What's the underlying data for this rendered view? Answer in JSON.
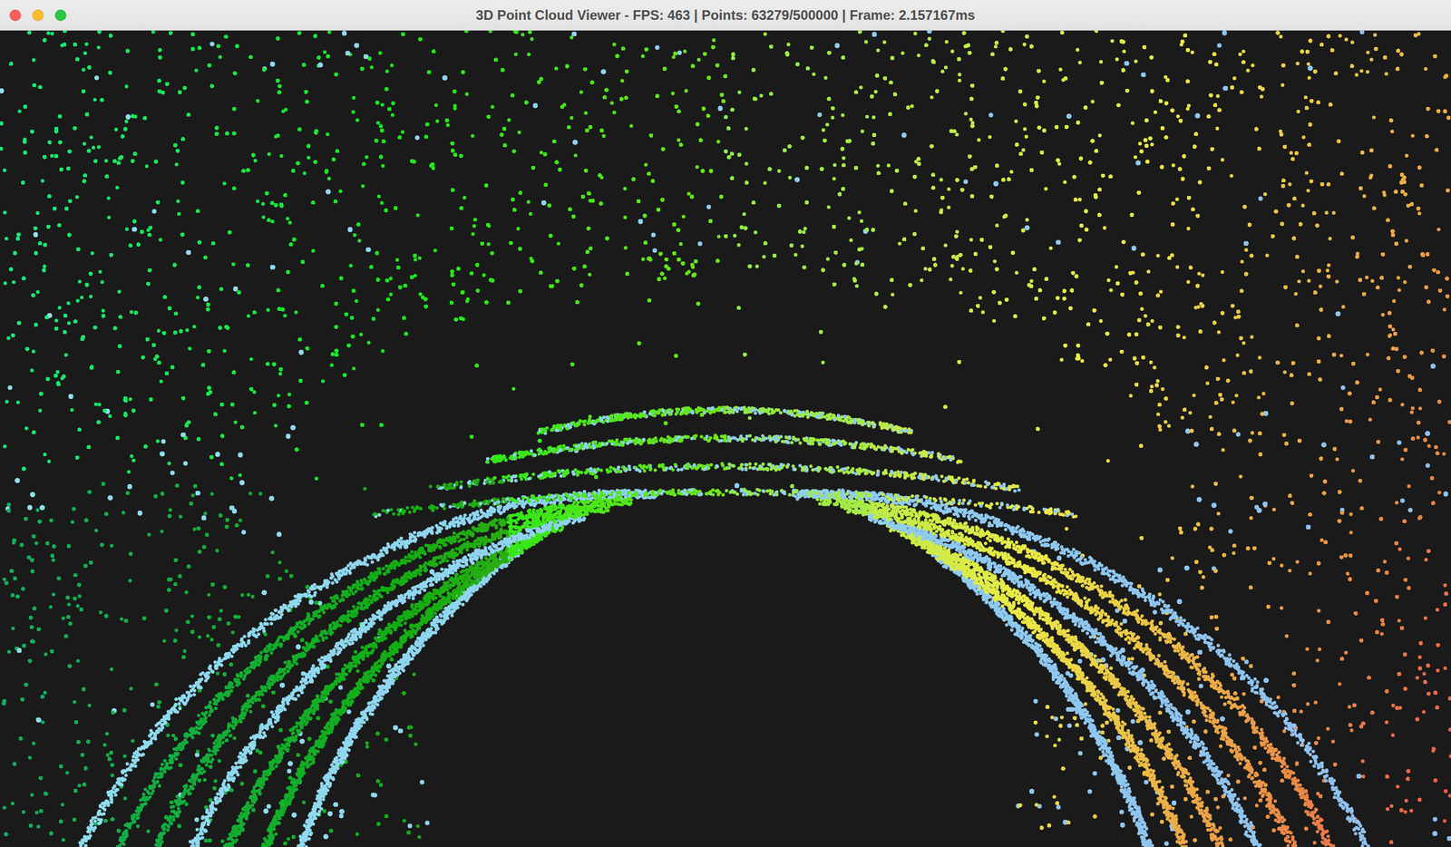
{
  "window": {
    "title": "3D Point Cloud Viewer - FPS: 463 | Points: 63279/500000 | Frame: 2.157167ms"
  },
  "controls": [
    {
      "name": "close",
      "color": "#ff5f57"
    },
    {
      "name": "minimize",
      "color": "#febc2e"
    },
    {
      "name": "zoom",
      "color": "#28c840"
    }
  ]
}
